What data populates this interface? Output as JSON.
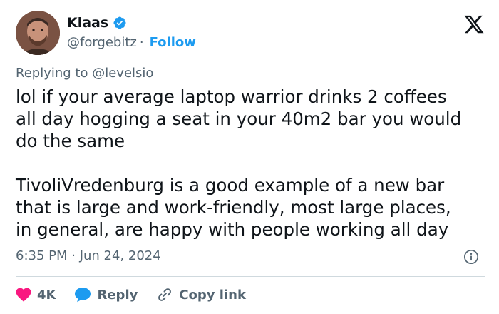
{
  "author": {
    "name": "Klaas",
    "handle": "@forgebitz",
    "separator": "·",
    "follow_label": "Follow"
  },
  "reply_to": {
    "prefix": "Replying to",
    "mention": "@levelsio"
  },
  "tweet": {
    "text": "lol if your average laptop warrior drinks 2 coffees\nall day hogging a seat in your 40m2 bar you would\ndo the same\n\nTivoliVredenburg is a good example of a new bar\nthat is large and work-friendly, most large places,\nin general, are happy with people working all day",
    "timestamp": "6:35 PM · Jun 24, 2024"
  },
  "actions": {
    "like_count": "4K",
    "reply_label": "Reply",
    "copy_link_label": "Copy link"
  },
  "colors": {
    "accent": "#1d9bf0",
    "like": "#f91880",
    "secondary_text": "#536471"
  },
  "icons": [
    "verified-badge-icon",
    "x-logo-icon",
    "info-icon",
    "heart-icon",
    "reply-bubble-icon",
    "link-icon"
  ]
}
